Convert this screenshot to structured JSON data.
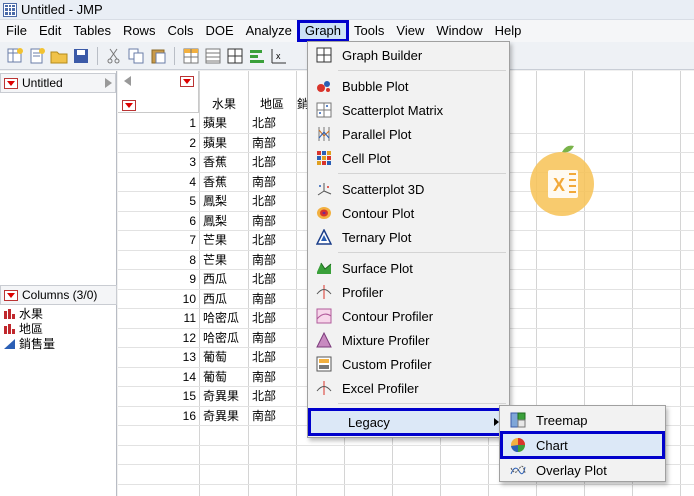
{
  "window": {
    "title": "Untitled - JMP"
  },
  "menubar": {
    "items": [
      "File",
      "Edit",
      "Tables",
      "Rows",
      "Cols",
      "DOE",
      "Analyze",
      "Graph",
      "Tools",
      "View",
      "Window",
      "Help"
    ],
    "active": "Graph"
  },
  "table_panel": {
    "title": "Untitled"
  },
  "columns_panel": {
    "title": "Columns (3/0)",
    "columns": [
      {
        "name": "水果",
        "icon": "nominal-bars-icon"
      },
      {
        "name": "地區",
        "icon": "nominal-bars-icon"
      },
      {
        "name": "銷售量",
        "icon": "continuous-triangle-icon"
      }
    ]
  },
  "grid": {
    "headers": [
      "水果",
      "地區",
      "銷"
    ],
    "rows": [
      {
        "n": "1",
        "fruit": "蘋果",
        "region": "北部"
      },
      {
        "n": "2",
        "fruit": "蘋果",
        "region": "南部"
      },
      {
        "n": "3",
        "fruit": "香蕉",
        "region": "北部"
      },
      {
        "n": "4",
        "fruit": "香蕉",
        "region": "南部"
      },
      {
        "n": "5",
        "fruit": "鳳梨",
        "region": "北部"
      },
      {
        "n": "6",
        "fruit": "鳳梨",
        "region": "南部"
      },
      {
        "n": "7",
        "fruit": "芒果",
        "region": "北部"
      },
      {
        "n": "8",
        "fruit": "芒果",
        "region": "南部"
      },
      {
        "n": "9",
        "fruit": "西瓜",
        "region": "北部"
      },
      {
        "n": "10",
        "fruit": "西瓜",
        "region": "南部"
      },
      {
        "n": "11",
        "fruit": "哈密瓜",
        "region": "北部"
      },
      {
        "n": "12",
        "fruit": "哈密瓜",
        "region": "南部"
      },
      {
        "n": "13",
        "fruit": "葡萄",
        "region": "北部"
      },
      {
        "n": "14",
        "fruit": "葡萄",
        "region": "南部"
      },
      {
        "n": "15",
        "fruit": "奇異果",
        "region": "北部"
      },
      {
        "n": "16",
        "fruit": "奇異果",
        "region": "南部"
      }
    ]
  },
  "graph_menu": {
    "items": [
      "Graph Builder",
      "Bubble Plot",
      "Scatterplot Matrix",
      "Parallel Plot",
      "Cell Plot",
      "Scatterplot 3D",
      "Contour Plot",
      "Ternary Plot",
      "Surface Plot",
      "Profiler",
      "Contour Profiler",
      "Mixture Profiler",
      "Custom Profiler",
      "Excel Profiler",
      "Legacy"
    ],
    "highlighted": "Legacy"
  },
  "legacy_submenu": {
    "items": [
      "Treemap",
      "Chart",
      "Overlay Plot"
    ],
    "highlighted": "Chart"
  },
  "colors": {
    "highlight_border": "#0000cc",
    "menu_bg": "#f2f2f2",
    "nominal_icon": "#c0282d",
    "continuous_icon": "#2b5fb5"
  }
}
